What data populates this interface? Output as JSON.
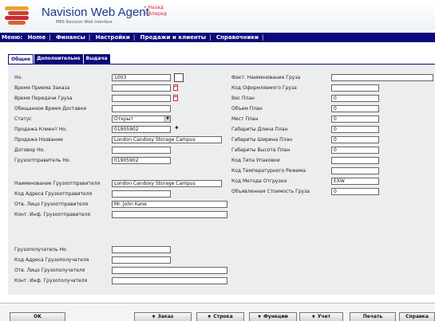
{
  "header": {
    "title": "Navision Web Agent",
    "subtitle": "MBS Navision Web Interface",
    "back_link": "Назад",
    "forward_link": "Вперед",
    "logo_icon": "navision-logo-icon",
    "accent_color": "#0c0a78"
  },
  "menu": {
    "label": "Меню:",
    "items": [
      "Home",
      "Финансы",
      "Настройки",
      "Продажи и клиенты",
      "Справочники"
    ]
  },
  "tabs": [
    "Общее",
    "Дополнительно",
    "Выдача"
  ],
  "left_fields": [
    {
      "label": "Но.",
      "value": "1003"
    },
    {
      "label": "Время Приема Заказа",
      "value": ""
    },
    {
      "label": "Время Передачи Груза",
      "value": ""
    },
    {
      "label": "Обещанное Время Доставки",
      "value": ""
    },
    {
      "label": "Статус",
      "value": "Открыт"
    },
    {
      "label": "Продажа Клиент Но.",
      "value": "01905902"
    },
    {
      "label": "Продажа Название",
      "value": "London Candoxy Storage Campus"
    },
    {
      "label": "Договор Но.",
      "value": ""
    },
    {
      "label": "Грузоотправитель Но.",
      "value": "01905902"
    },
    {
      "label": "Наименование Грузоотправителя",
      "value": "London Candoxy Storage Campus"
    },
    {
      "label": "Код Адреса Грузоотправителя",
      "value": ""
    },
    {
      "label": "Отв. Лицо Грузоотправителя",
      "value": "Mr. John Kane"
    },
    {
      "label": "Конт. Инф. Грузоотправителя",
      "value": ""
    },
    {
      "label": "Грузополучатель Но.",
      "value": ""
    },
    {
      "label": "Код Адреса Грузополучателя",
      "value": ""
    },
    {
      "label": "Отв. Лицо Грузополучателя",
      "value": ""
    },
    {
      "label": "Конт. Инф. Грузополучателя",
      "value": ""
    }
  ],
  "right_fields": [
    {
      "label": "Факт. Наименование Груза",
      "value": ""
    },
    {
      "label": "Код Оформляемого Груза",
      "value": ""
    },
    {
      "label": "Вес План",
      "value": "0"
    },
    {
      "label": "Объем План",
      "value": "0"
    },
    {
      "label": "Мест План",
      "value": "0"
    },
    {
      "label": "Габариты Длина План",
      "value": "0"
    },
    {
      "label": "Габариты Ширина План",
      "value": "0"
    },
    {
      "label": "Габариты Высота План",
      "value": "0"
    },
    {
      "label": "Код Типа Упаковки",
      "value": ""
    },
    {
      "label": "Код Температурного Режима",
      "value": ""
    },
    {
      "label": "Код Метода Отгрузки",
      "value": "EXW"
    },
    {
      "label": "Объявленная Стоимость Груза",
      "value": "0"
    }
  ],
  "buttons": {
    "ok": "OK",
    "order": "Заказ",
    "line": "Строка",
    "functions": "Функции",
    "posting": "Учет",
    "print": "Печать",
    "help": "Справка"
  }
}
